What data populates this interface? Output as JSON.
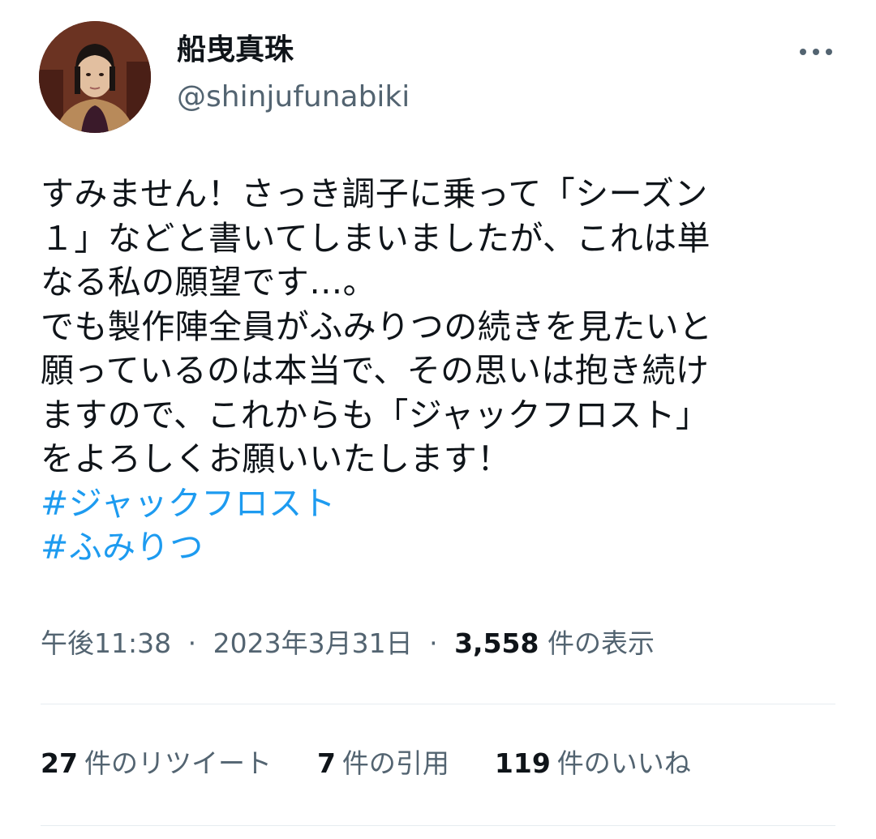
{
  "author": {
    "display_name": "船曳真珠",
    "handle": "@shinjufunabiki"
  },
  "tweet": {
    "lines": [
      "すみません！さっき調子に乗って「シーズン",
      "１」などと書いてしまいましたが、これは単",
      "なる私の願望です…。",
      "でも製作陣全員がふみりつの続きを見たいと",
      "願っているのは本当で、その思いは抱き続け",
      "ますので、これからも「ジャックフロスト」",
      "をよろしくお願いいたします！"
    ],
    "hashtags": [
      "#ジャックフロスト",
      "#ふみりつ"
    ]
  },
  "meta": {
    "time": "午後11:38",
    "date": "2023年3月31日",
    "separator": "·",
    "views_count": "3,558",
    "views_label": "件の表示"
  },
  "stats": {
    "retweets_count": "27",
    "retweets_label": "件のリツイート",
    "quotes_count": "7",
    "quotes_label": "件の引用",
    "likes_count": "119",
    "likes_label": "件のいいね"
  },
  "colors": {
    "link": "#1d9bf0",
    "secondary_text": "#536471",
    "primary_text": "#0f1419",
    "divider": "#e6ecf0"
  },
  "icons": {
    "more": "more-horizontal-icon"
  }
}
